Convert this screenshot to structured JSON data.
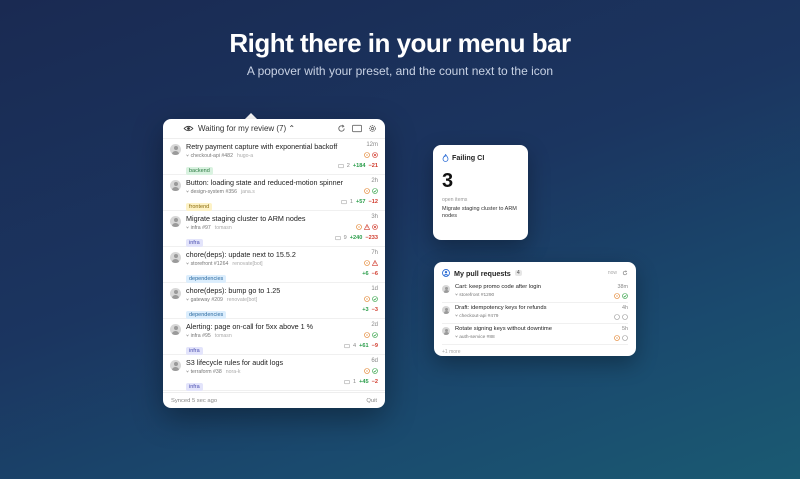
{
  "hero": {
    "title": "Right there in your menu bar",
    "subtitle": "A popover with your preset, and the count next to the icon"
  },
  "popover": {
    "preset_label": "Waiting for my review (7)",
    "footer_synced": "Synced 5 sec ago",
    "footer_quit": "Quit",
    "rows": [
      {
        "title": "Retry payment capture with exponential backoff",
        "time": "12m",
        "repo": "checkout-api #482",
        "branch": "hugo-a",
        "tag": "backend",
        "comments": "2",
        "add": "+184",
        "del": "−21",
        "status": [
          "pending",
          "fail"
        ]
      },
      {
        "title": "Button: loading state and reduced-motion spinner",
        "time": "2h",
        "repo": "design-system #356",
        "branch": "jana.s",
        "tag": "frontend",
        "comments": "1",
        "add": "+57",
        "del": "−12",
        "status": [
          "pending",
          "pass"
        ]
      },
      {
        "title": "Migrate staging cluster to ARM nodes",
        "time": "3h",
        "repo": "infra #97",
        "branch": "tomasn",
        "tag": "infra",
        "comments": "9",
        "add": "+240",
        "del": "−233",
        "status": [
          "pending",
          "warn",
          "fail"
        ]
      },
      {
        "title": "chore(deps): update next to 15.5.2",
        "time": "7h",
        "repo": "storefront #1264",
        "branch": "renovate[bot]",
        "tag": "dependencies",
        "comments": "",
        "add": "+6",
        "del": "−6",
        "status": [
          "pending",
          "warn"
        ]
      },
      {
        "title": "chore(deps): bump go to 1.25",
        "time": "1d",
        "repo": "gateway #209",
        "branch": "renovate[bot]",
        "tag": "dependencies",
        "comments": "",
        "add": "+3",
        "del": "−3",
        "status": [
          "pending",
          "pass"
        ]
      },
      {
        "title": "Alerting: page on-call for 5xx above 1 %",
        "time": "2d",
        "repo": "infra #95",
        "branch": "tomasn",
        "tag": "infra",
        "comments": "4",
        "add": "+61",
        "del": "−9",
        "status": [
          "pending",
          "pass"
        ]
      },
      {
        "title": "S3 lifecycle rules for audit logs",
        "time": "6d",
        "repo": "terraform #38",
        "branch": "nora-k",
        "tag": "infra",
        "comments": "1",
        "add": "+45",
        "del": "−2",
        "status": [
          "pending",
          "pass"
        ]
      }
    ]
  },
  "ci_widget": {
    "title": "Failing CI",
    "count": "3",
    "label": "open items",
    "item": "Migrate staging cluster to ARM nodes"
  },
  "pr_widget": {
    "title": "My pull requests",
    "badge": "4",
    "header_time": "now",
    "rows": [
      {
        "title": "Cart: keep promo code after login",
        "repo": "storefront #1290",
        "time": "38m",
        "status": [
          "pending",
          "pass"
        ]
      },
      {
        "title": "Draft: idempotency keys for refunds",
        "repo": "checkout-api #479",
        "time": "4h",
        "status": [
          "draft",
          "neutral"
        ]
      },
      {
        "title": "Rotate signing keys without downtime",
        "repo": "auth-service #88",
        "time": "5h",
        "status": [
          "pending",
          "neutral"
        ]
      }
    ],
    "more": "+1 more"
  },
  "colors": {
    "pass": "#2ea043",
    "fail": "#d0392b",
    "pending": "#e07b20",
    "tag_backend": "#d9f2e0",
    "tag_frontend": "#fdf2c6",
    "tag_infra": "#e3e4fb",
    "tag_deps": "#dceefd"
  }
}
